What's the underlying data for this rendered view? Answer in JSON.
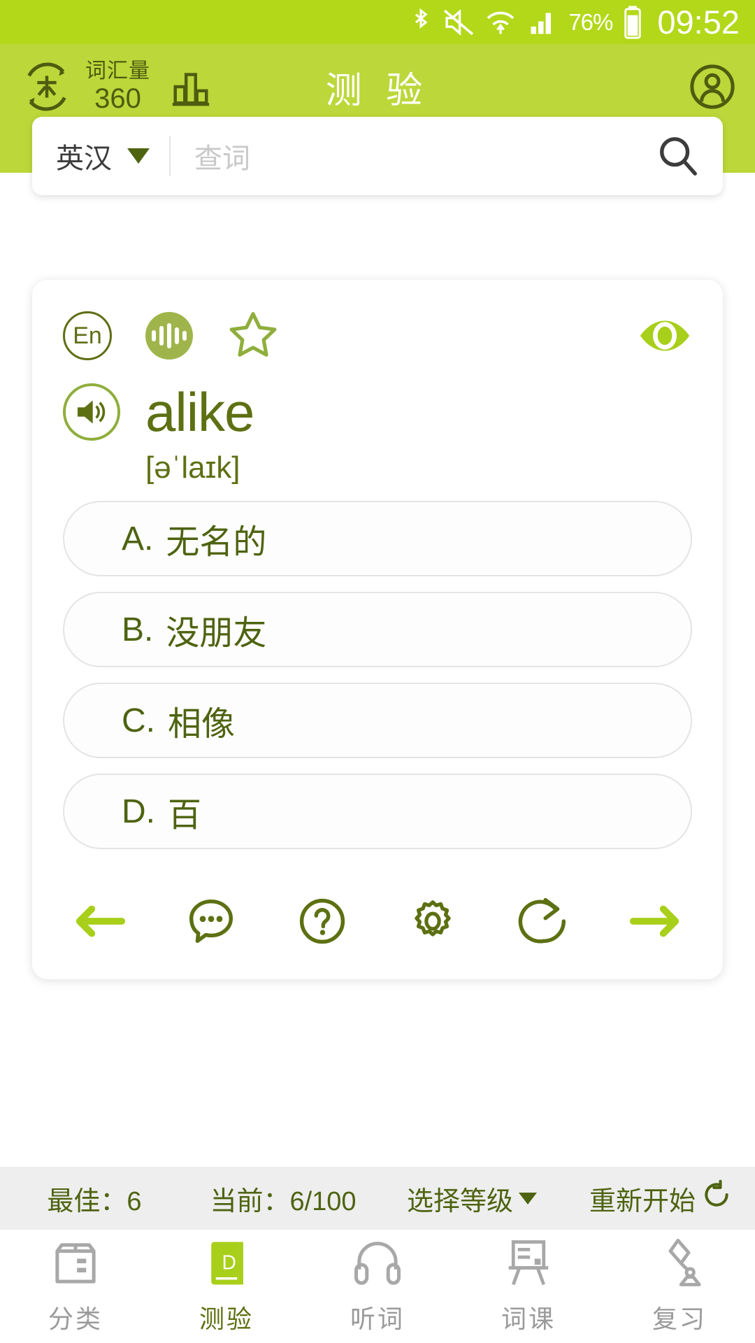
{
  "statusbar": {
    "battery_percent": "76%",
    "time": "09:52",
    "icons": [
      "bluetooth-icon",
      "mute-icon",
      "wifi-icon",
      "signal-icon",
      "battery-icon"
    ]
  },
  "header": {
    "logo": "米",
    "vocab_label": "词汇量",
    "vocab_count": "360",
    "chart_icon": "bar-chart-icon",
    "title": "测 验",
    "avatar_icon": "account-icon"
  },
  "search": {
    "language": "英汉",
    "placeholder": "查词",
    "search_icon": "search-icon"
  },
  "card": {
    "lang_badge": "En",
    "wave_icon": "waveform-icon",
    "star_icon": "star-outline-icon",
    "eye_icon": "eye-icon",
    "speaker_icon": "speaker-icon",
    "word": "alike",
    "phonetic": "[əˈlaɪk]",
    "options": [
      {
        "key": "A.",
        "text": "无名的"
      },
      {
        "key": "B.",
        "text": "没朋友"
      },
      {
        "key": "C.",
        "text": "相像"
      },
      {
        "key": "D.",
        "text": "百"
      }
    ],
    "toolbar": [
      {
        "name": "prev-arrow-icon"
      },
      {
        "name": "comment-icon"
      },
      {
        "name": "help-icon"
      },
      {
        "name": "settings-icon"
      },
      {
        "name": "share-icon"
      },
      {
        "name": "next-arrow-icon"
      }
    ]
  },
  "stats": {
    "best": "最佳：6",
    "current": "当前：6/100",
    "level": "选择等级",
    "restart": "重新开始"
  },
  "bottomnav": {
    "items": [
      {
        "label": "分类",
        "icon": "category-box-icon",
        "active": false
      },
      {
        "label": "测验",
        "icon": "quiz-book-icon",
        "active": true
      },
      {
        "label": "听词",
        "icon": "headphones-icon",
        "active": false
      },
      {
        "label": "词课",
        "icon": "easel-icon",
        "active": false
      },
      {
        "label": "复习",
        "icon": "desk-lamp-icon",
        "active": false
      }
    ]
  },
  "colors": {
    "header_green": "#bcd73a",
    "status_green": "#b2d819",
    "accent_dark": "#5d7012",
    "bright_green": "#a8cf1a"
  }
}
